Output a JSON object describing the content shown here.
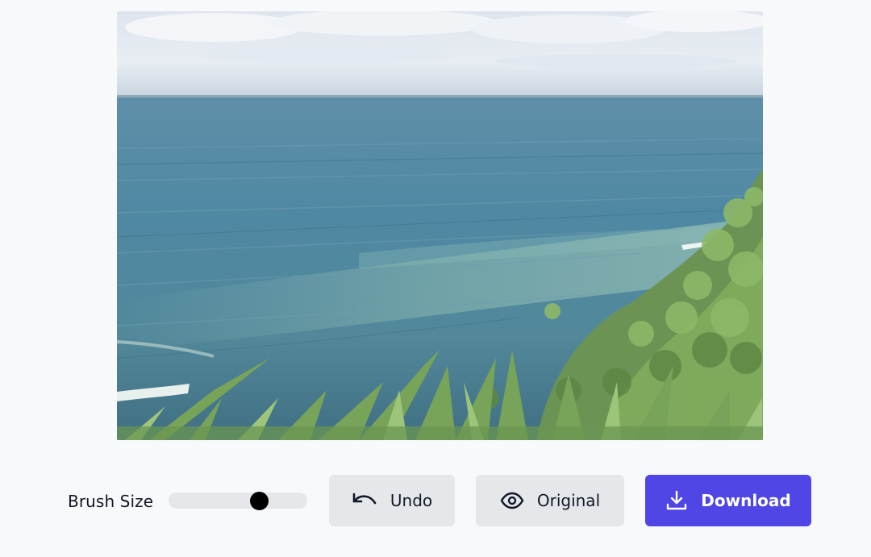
{
  "editor": {
    "image_alt": "Ocean coastline with green plants"
  },
  "toolbar": {
    "brush_size_label": "Brush Size",
    "brush_size_value": 0.65,
    "undo_label": "Undo",
    "original_label": "Original",
    "download_label": "Download",
    "undo_icon": "undo-arrow-icon",
    "original_icon": "eye-icon",
    "download_icon": "download-icon"
  },
  "colors": {
    "page_background": "#f8f9fb",
    "secondary_button": "#e5e7eb",
    "primary_button": "#4f46e5",
    "slider_thumb": "#000000"
  }
}
